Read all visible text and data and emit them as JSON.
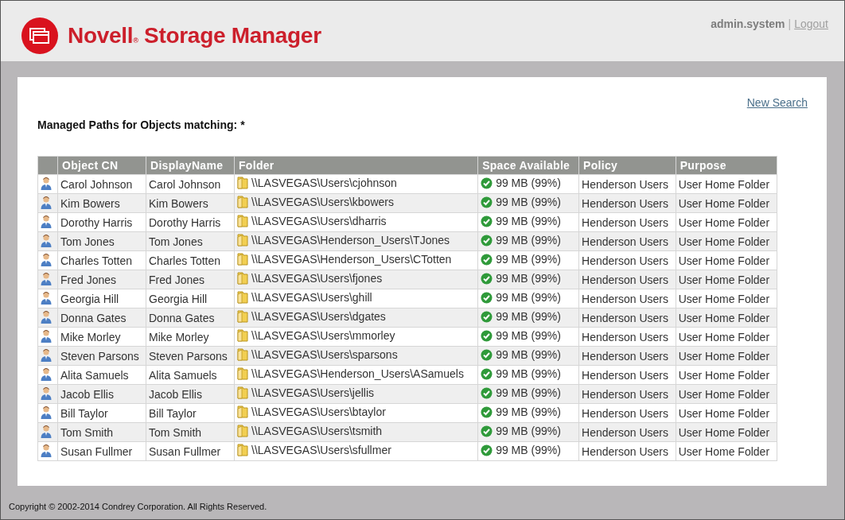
{
  "header": {
    "title": "Novell$_{®}$ Storage Manager",
    "user": "admin.system",
    "separator": "|",
    "logout": "Logout"
  },
  "content": {
    "new_search": "New Search",
    "heading": "Managed Paths for Objects matching: *",
    "table": {
      "columns": [
        "Object CN",
        "DisplayName",
        "Folder",
        "Space Available",
        "Policy",
        "Purpose"
      ],
      "rows": [
        {
          "cn": "Carol Johnson",
          "display": "Carol Johnson",
          "folder": "\\\\LASVEGAS\\Users\\cjohnson",
          "space": "99 MB (99%)",
          "policy": "Henderson Users",
          "purpose": "User Home Folder"
        },
        {
          "cn": "Kim Bowers",
          "display": "Kim Bowers",
          "folder": "\\\\LASVEGAS\\Users\\kbowers",
          "space": "99 MB (99%)",
          "policy": "Henderson Users",
          "purpose": "User Home Folder"
        },
        {
          "cn": "Dorothy Harris",
          "display": "Dorothy Harris",
          "folder": "\\\\LASVEGAS\\Users\\dharris",
          "space": "99 MB (99%)",
          "policy": "Henderson Users",
          "purpose": "User Home Folder"
        },
        {
          "cn": "Tom Jones",
          "display": "Tom Jones",
          "folder": "\\\\LASVEGAS\\Henderson_Users\\TJones",
          "space": "99 MB (99%)",
          "policy": "Henderson Users",
          "purpose": "User Home Folder"
        },
        {
          "cn": "Charles Totten",
          "display": "Charles Totten",
          "folder": "\\\\LASVEGAS\\Henderson_Users\\CTotten",
          "space": "99 MB (99%)",
          "policy": "Henderson Users",
          "purpose": "User Home Folder"
        },
        {
          "cn": "Fred Jones",
          "display": "Fred Jones",
          "folder": "\\\\LASVEGAS\\Users\\fjones",
          "space": "99 MB (99%)",
          "policy": "Henderson Users",
          "purpose": "User Home Folder"
        },
        {
          "cn": "Georgia Hill",
          "display": "Georgia Hill",
          "folder": "\\\\LASVEGAS\\Users\\ghill",
          "space": "99 MB (99%)",
          "policy": "Henderson Users",
          "purpose": "User Home Folder"
        },
        {
          "cn": "Donna Gates",
          "display": "Donna Gates",
          "folder": "\\\\LASVEGAS\\Users\\dgates",
          "space": "99 MB (99%)",
          "policy": "Henderson Users",
          "purpose": "User Home Folder"
        },
        {
          "cn": "Mike Morley",
          "display": "Mike Morley",
          "folder": "\\\\LASVEGAS\\Users\\mmorley",
          "space": "99 MB (99%)",
          "policy": "Henderson Users",
          "purpose": "User Home Folder"
        },
        {
          "cn": "Steven Parsons",
          "display": "Steven Parsons",
          "folder": "\\\\LASVEGAS\\Users\\sparsons",
          "space": "99 MB (99%)",
          "policy": "Henderson Users",
          "purpose": "User Home Folder"
        },
        {
          "cn": "Alita Samuels",
          "display": "Alita Samuels",
          "folder": "\\\\LASVEGAS\\Henderson_Users\\ASamuels",
          "space": "99 MB (99%)",
          "policy": "Henderson Users",
          "purpose": "User Home Folder"
        },
        {
          "cn": "Jacob Ellis",
          "display": "Jacob Ellis",
          "folder": "\\\\LASVEGAS\\Users\\jellis",
          "space": "99 MB (99%)",
          "policy": "Henderson Users",
          "purpose": "User Home Folder"
        },
        {
          "cn": "Bill Taylor",
          "display": "Bill Taylor",
          "folder": "\\\\LASVEGAS\\Users\\btaylor",
          "space": "99 MB (99%)",
          "policy": "Henderson Users",
          "purpose": "User Home Folder"
        },
        {
          "cn": "Tom Smith",
          "display": "Tom Smith",
          "folder": "\\\\LASVEGAS\\Users\\tsmith",
          "space": "99 MB (99%)",
          "policy": "Henderson Users",
          "purpose": "User Home Folder"
        },
        {
          "cn": "Susan Fullmer",
          "display": "Susan Fullmer",
          "folder": "\\\\LASVEGAS\\Users\\sfullmer",
          "space": "99 MB (99%)",
          "policy": "Henderson Users",
          "purpose": "User Home Folder"
        }
      ]
    }
  },
  "footer": {
    "copyright": "Copyright © 2002-2014 Condrey Corporation. All Rights Reserved."
  }
}
